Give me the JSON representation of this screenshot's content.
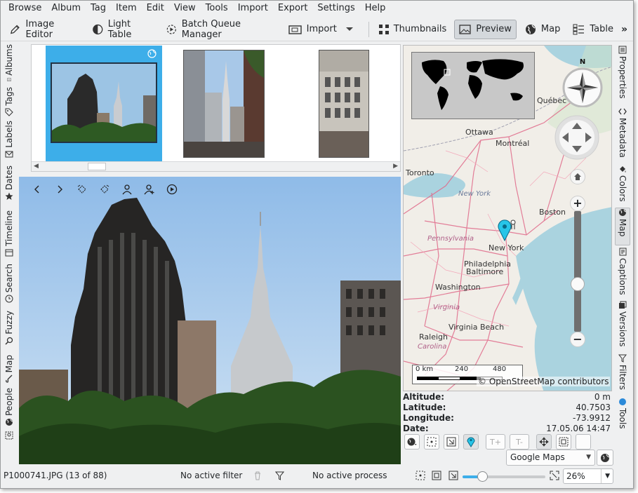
{
  "menu": [
    "Browse",
    "Album",
    "Tag",
    "Item",
    "Edit",
    "View",
    "Tools",
    "Import",
    "Export",
    "Settings",
    "Help"
  ],
  "toolbar": {
    "image_editor": "Image Editor",
    "light_table": "Light Table",
    "batch_queue": "Batch Queue Manager",
    "import": "Import",
    "thumbnails": "Thumbnails",
    "preview": "Preview",
    "map": "Map",
    "table": "Table",
    "more": "»"
  },
  "left_sidebar": [
    "Albums",
    "Tags",
    "Labels",
    "Dates",
    "Timeline",
    "Search",
    "Fuzzy",
    "Map",
    "People"
  ],
  "right_sidebar": [
    "Properties",
    "Metadata",
    "Colors",
    "Map",
    "Captions",
    "Versions",
    "Filters",
    "Tools"
  ],
  "map": {
    "cities": [
      "Québec",
      "Ottawa",
      "Montréal",
      "Toronto",
      "Boston",
      "New York",
      "Philadelphia",
      "Baltimore",
      "Washington",
      "Virginia Beach",
      "Raleigh"
    ],
    "regions": [
      "New York",
      "Pennsylvania",
      "Virginia",
      "Carolina"
    ],
    "compass_n": "N",
    "scale": {
      "a": "0 km",
      "b": "240",
      "c": "480"
    },
    "copyright": "© OpenStreetMap contributors",
    "zoom_in": "+",
    "zoom_out": "−",
    "zoom_level": 0.38
  },
  "geo": {
    "altitude_label": "Altitude:",
    "altitude": "0 m",
    "latitude_label": "Latitude:",
    "latitude": "40.7503",
    "longitude_label": "Longitude:",
    "longitude": "-73.9912",
    "date_label": "Date:",
    "date": "17.05.06 14:47"
  },
  "geo_buttons": {
    "t_plus": "T+",
    "t_minus": "T-"
  },
  "map_provider": "Google Maps",
  "status": {
    "file": "P1000741.JPG (13 of 88)",
    "filter": "No active filter",
    "process": "No active process",
    "zoom": "26%",
    "zoom_level": 0.24
  },
  "colors": {
    "accent": "#3daee9",
    "marker": "#27c5e8"
  }
}
